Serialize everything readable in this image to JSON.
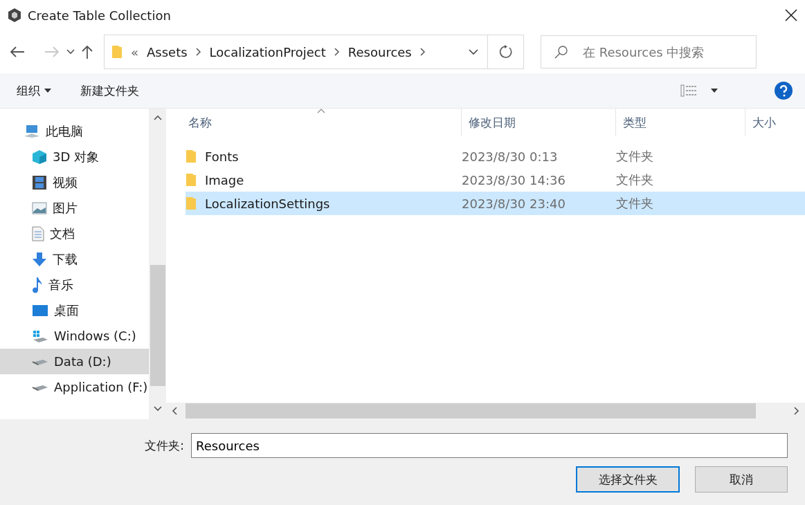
{
  "window": {
    "title": "Create Table Collection"
  },
  "address": {
    "overflow": "«",
    "segments": [
      "Assets",
      "LocalizationProject",
      "Resources"
    ]
  },
  "search": {
    "placeholder": "在 Resources 中搜索"
  },
  "toolbar": {
    "organize": "组织",
    "new_folder": "新建文件夹"
  },
  "sidebar": {
    "items": [
      {
        "kind": "computer",
        "label": "此电脑",
        "selected": false,
        "children": [
          {
            "kind": "cube",
            "label": "3D 对象",
            "selected": false
          },
          {
            "kind": "video",
            "label": "视频",
            "selected": false
          },
          {
            "kind": "picture",
            "label": "图片",
            "selected": false
          },
          {
            "kind": "document",
            "label": "文档",
            "selected": false
          },
          {
            "kind": "download",
            "label": "下载",
            "selected": false
          },
          {
            "kind": "music",
            "label": "音乐",
            "selected": false
          },
          {
            "kind": "desktop",
            "label": "桌面",
            "selected": false
          },
          {
            "kind": "windows-drive",
            "label": "Windows (C:)",
            "selected": false
          },
          {
            "kind": "drive",
            "label": "Data (D:)",
            "selected": true
          },
          {
            "kind": "drive",
            "label": "Application (F:)",
            "selected": false
          }
        ]
      }
    ]
  },
  "table": {
    "columns": [
      "名称",
      "修改日期",
      "类型",
      "大小"
    ],
    "rows": [
      {
        "name": "Fonts",
        "date": "2023/8/30 0:13",
        "type": "文件夹",
        "selected": false
      },
      {
        "name": "Image",
        "date": "2023/8/30 14:36",
        "type": "文件夹",
        "selected": false
      },
      {
        "name": "LocalizationSettings",
        "date": "2023/8/30 23:40",
        "type": "文件夹",
        "selected": true
      }
    ]
  },
  "footer": {
    "folder_label": "文件夹:",
    "folder_value": "Resources",
    "buttons": [
      {
        "label": "选择文件夹",
        "default": true
      },
      {
        "label": "取消",
        "default": false
      }
    ]
  }
}
